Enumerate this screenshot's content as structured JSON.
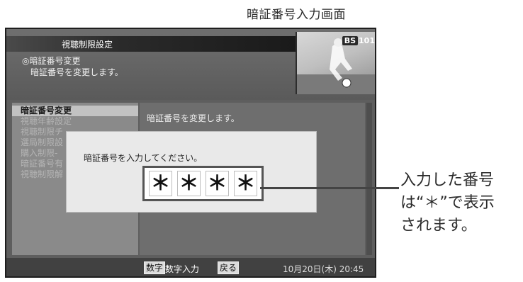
{
  "caption": {
    "title": "暗証番号入力画面"
  },
  "screen": {
    "title": "視聴制限設定",
    "header_line1": "◎暗証番号変更",
    "header_line2": "暗証番号を変更します。",
    "channel": {
      "badge": "BS",
      "number": "101"
    },
    "menu": [
      {
        "label": "暗証番号変更",
        "active": true
      },
      {
        "label": "視聴年齢設定",
        "active": false
      },
      {
        "label": "視聴制限チ",
        "active": false
      },
      {
        "label": "選局制限設",
        "active": false
      },
      {
        "label": "購入制限-",
        "active": false
      },
      {
        "label": "暗証番号有",
        "active": false
      },
      {
        "label": "視聴制限解",
        "active": false
      }
    ],
    "description": "暗証番号を変更します。",
    "dialog": {
      "message": "暗証番号を入力してください。",
      "pin": [
        "＊",
        "＊",
        "＊",
        "＊"
      ]
    },
    "footer": {
      "digit_key": "数字",
      "digit_label": "数字入力",
      "back_key": "戻る",
      "datetime": "10月20日(木) 20:45"
    }
  },
  "callout": {
    "line1": "入力した番号",
    "line2": "は“＊”で表示",
    "line3": "されます。"
  },
  "colors": {
    "screen_bg": "#5e5e5e",
    "dialog_bg": "#e9e9e9",
    "footer_bg": "#414141"
  }
}
